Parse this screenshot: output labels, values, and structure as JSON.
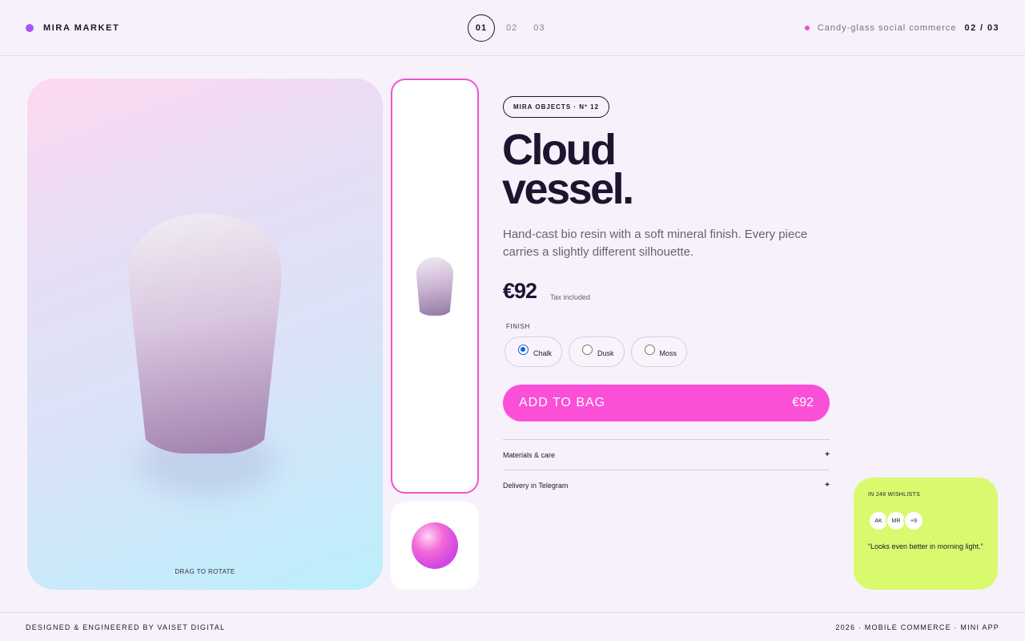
{
  "header": {
    "brand": "MIRA MARKET",
    "steps": [
      "01",
      "02",
      "03"
    ],
    "active_step": "01",
    "tagline": "Candy-glass social commerce",
    "pager": "02 / 03"
  },
  "viewer": {
    "hint": "DRAG TO ROTATE"
  },
  "thumbnails": [
    {
      "name": "vase",
      "selected": true
    },
    {
      "name": "sphere",
      "selected": false
    }
  ],
  "product": {
    "badge": "MIRA OBJECTS · Nº 12",
    "title_line1": "Cloud",
    "title_line2": "vessel.",
    "description": "Hand-cast bio resin with a soft mineral finish. Every piece carries a slightly different silhouette.",
    "price": "€92",
    "tax_note": "Tax included",
    "finish_label": "FINISH",
    "finishes": [
      {
        "label": "Chalk",
        "checked": true
      },
      {
        "label": "Dusk",
        "checked": false
      },
      {
        "label": "Moss",
        "checked": false
      }
    ],
    "add_to_bag_label": "ADD TO BAG",
    "add_to_bag_price": "€92",
    "accordions": [
      {
        "label": "Materials & care",
        "icon": "+"
      },
      {
        "label": "Delivery in Telegram",
        "icon": "+"
      }
    ]
  },
  "social": {
    "wishlists": "IN 248 WISHLISTS",
    "avatars": [
      "AK",
      "MR",
      "+9"
    ],
    "quote": "“Looks even better in morning light.”"
  },
  "footer": {
    "left": "DESIGNED & ENGINEERED BY VAISET DIGITAL",
    "right": "2026 · MOBILE COMMERCE · MINI APP"
  },
  "colors": {
    "accent_pink": "#fb4fd8",
    "brand_purple": "#a855f7",
    "lime_card": "#d9fa6e",
    "ink": "#1f1430"
  }
}
